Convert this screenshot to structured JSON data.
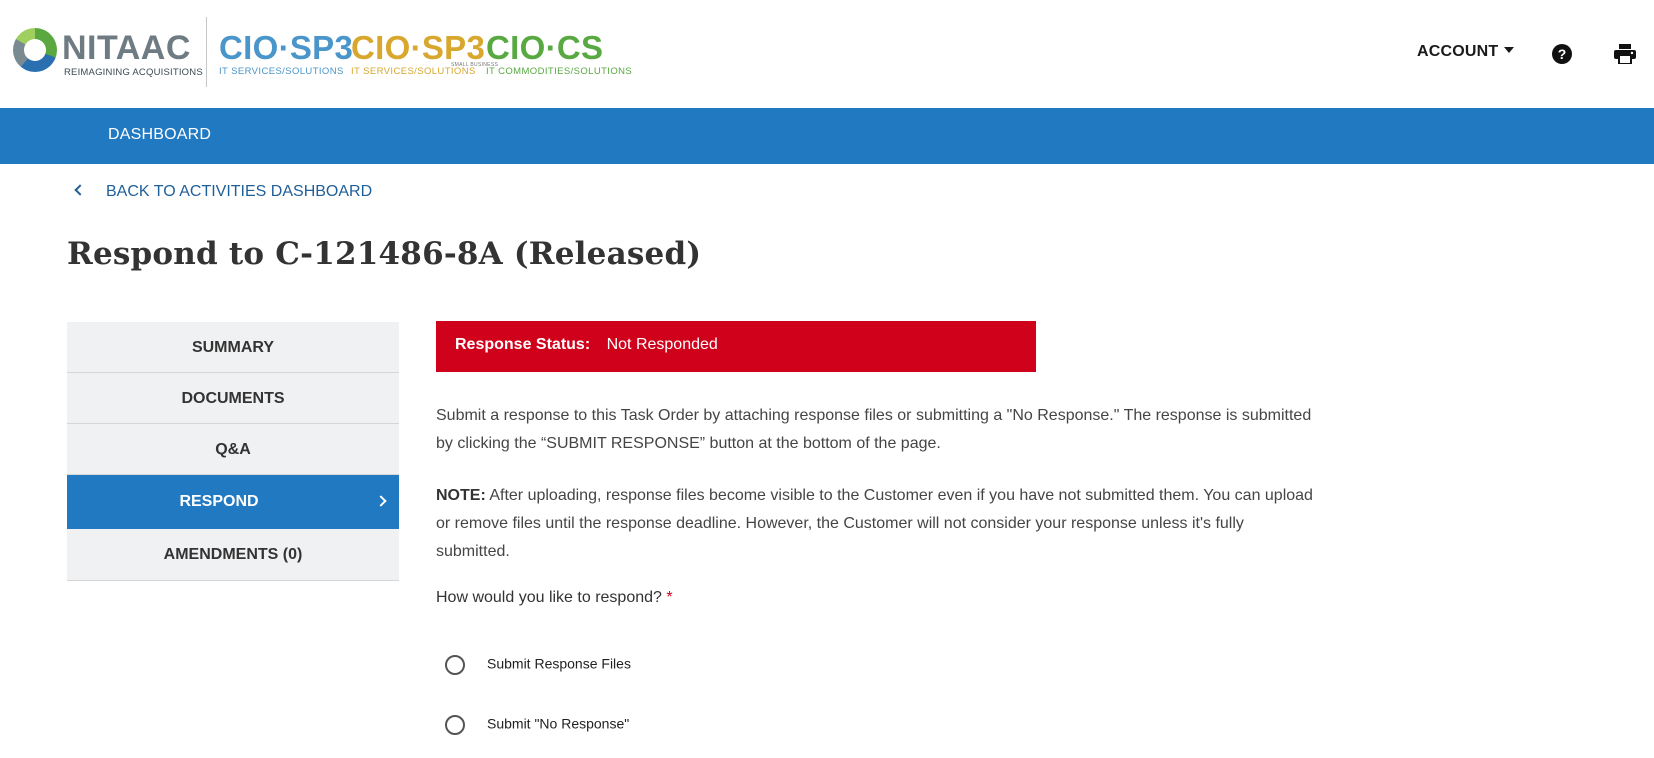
{
  "header": {
    "brand_name": "NITAAC",
    "brand_tagline": "REIMAGINING ACQUISITIONS",
    "contracts": [
      {
        "name": "CIO·SP3",
        "sub": "IT SERVICES/SOLUTIONS",
        "color": "#4a95c9"
      },
      {
        "name": "CIO·SP3",
        "sub": "IT SERVICES/SOLUTIONS",
        "color": "#d8a72d"
      },
      {
        "name": "CIO·CS",
        "sub": "IT COMMODITIES/SOLUTIONS",
        "color": "#58a941"
      }
    ],
    "small_business_label": "SMALL BUSINESS",
    "account_label": "ACCOUNT",
    "help_icon": "?"
  },
  "nav": {
    "dashboard_label": "DASHBOARD",
    "color": "#2179c2"
  },
  "back_link": "BACK TO ACTIVITIES DASHBOARD",
  "page_title": "Respond to C-121486-8A (Released)",
  "sidebar": {
    "items": [
      {
        "label": "SUMMARY"
      },
      {
        "label": "DOCUMENTS"
      },
      {
        "label": "Q&A"
      },
      {
        "label": "RESPOND",
        "active": true
      },
      {
        "label": "AMENDMENTS (0)"
      }
    ]
  },
  "status": {
    "label": "Response Status:",
    "value": "Not Responded",
    "color": "#d0011b"
  },
  "instructions": {
    "line1": "Submit a response to this Task Order by attaching response files or submitting a \"No Response.\" The response is submitted by clicking the “SUBMIT RESPONSE” button at the bottom of the page.",
    "note_label": "NOTE:",
    "note_text": " After uploading, response files become visible to the Customer even if you have not submitted them. You can upload or remove files until the response deadline. However, the Customer will not consider your response unless it's fully submitted."
  },
  "question": {
    "label": "How would you like to respond?",
    "required_mark": "*",
    "options": [
      {
        "label": "Submit Response Files"
      },
      {
        "label": "Submit \"No Response\""
      }
    ]
  }
}
